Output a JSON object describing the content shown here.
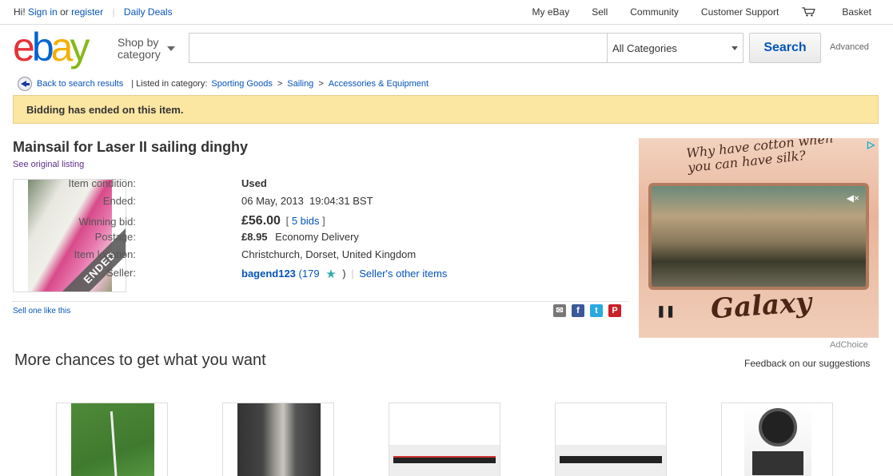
{
  "topbar": {
    "greeting": "Hi!",
    "sign_in": "Sign in",
    "or": "or",
    "register": "register",
    "daily_deals": "Daily Deals",
    "my_ebay": "My eBay",
    "sell": "Sell",
    "community": "Community",
    "customer_support": "Customer Support",
    "basket": "Basket"
  },
  "header": {
    "logo": {
      "e": "e",
      "b": "b",
      "a": "a",
      "y": "y"
    },
    "shop_by_line1": "Shop by",
    "shop_by_line2": "category",
    "search_placeholder": "",
    "category": "All Categories",
    "search_button": "Search",
    "advanced": "Advanced"
  },
  "breadcrumb": {
    "back": "Back to search results",
    "listed_in": "| Listed in category:",
    "items": [
      "Sporting Goods",
      "Sailing",
      "Accessories & Equipment"
    ]
  },
  "notice": "Bidding has ended on this item.",
  "item": {
    "title": "Mainsail for Laser II sailing dinghy",
    "see_original": "See original listing",
    "ended_badge": "ENDED",
    "condition_label": "Item condition:",
    "condition": "Used",
    "ended_label": "Ended:",
    "ended": "06 May, 2013  19:04:31 BST",
    "winning_label": "Winning bid:",
    "winning_bid": "£56.00",
    "bids_open": "[",
    "bids": "5 bids",
    "bids_close": "]",
    "postage_label": "Postage:",
    "postage_price": "£8.95",
    "postage_type": "Economy Delivery",
    "location_label": "Item location:",
    "location": "Christchurch, Dorset, United Kingdom",
    "seller_label": "Seller:",
    "seller": "bagend123",
    "feedback": "(179",
    "feedback_close": ")",
    "seller_other": "Seller's other items",
    "sell_like": "Sell one like this"
  },
  "share": {
    "email": "✉",
    "facebook": "f",
    "twitter": "t",
    "pinterest": "P"
  },
  "ad": {
    "slogan": "Why have cotton when you can have silk?",
    "brand": "Galaxy",
    "adchoice": "AdChoice"
  },
  "more": {
    "title": "More chances to get what you want",
    "feedback": "Feedback on our suggestions"
  },
  "colors": {
    "link": "#0654ba",
    "notice_bg": "#fbe6a2",
    "ebay_red": "#e53238",
    "ebay_blue": "#0064d2",
    "ebay_yellow": "#f5af02",
    "ebay_green": "#86b817"
  }
}
